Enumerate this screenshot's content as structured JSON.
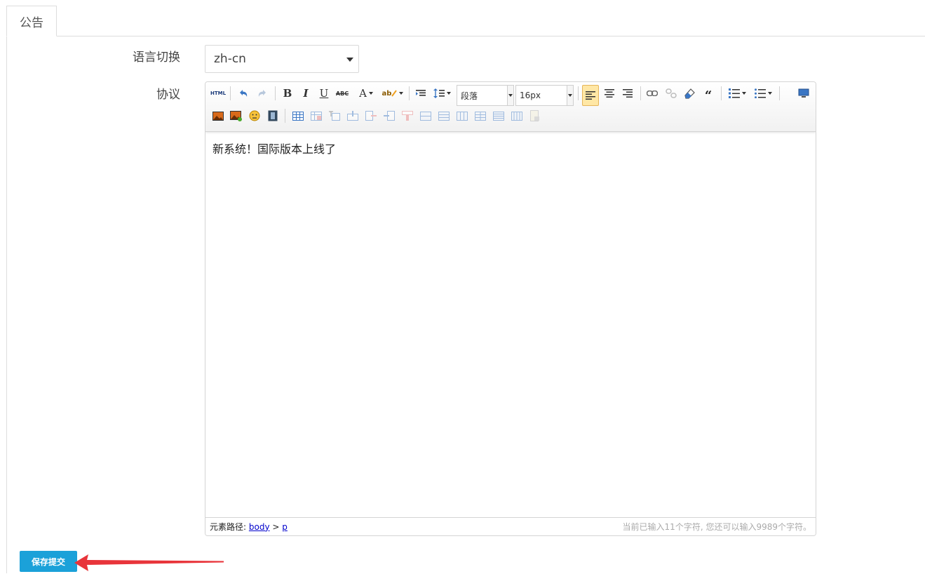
{
  "tabs": [
    {
      "label": "公告"
    }
  ],
  "form": {
    "language_label": "语言切换",
    "language_value": "zh-cn",
    "agreement_label": "协议"
  },
  "editor": {
    "toolbar": {
      "paragraph": "段落",
      "font_size": "16px",
      "html_label": "HTML",
      "bold": "B",
      "italic": "I",
      "underline": "U",
      "strike": "ABC",
      "font_color": "A",
      "highlight": "ab"
    },
    "content": "新系统！国际版本上线了",
    "status": {
      "path_label": "元素路径:",
      "path_body": "body",
      "path_sep": ">",
      "path_p": "p",
      "counter": "当前已输入11个字符, 您还可以输入9989个字符。"
    }
  },
  "buttons": {
    "submit": "保存提交"
  },
  "colors": {
    "accent": "#1ba1d9",
    "arrow": "#e8343a"
  }
}
